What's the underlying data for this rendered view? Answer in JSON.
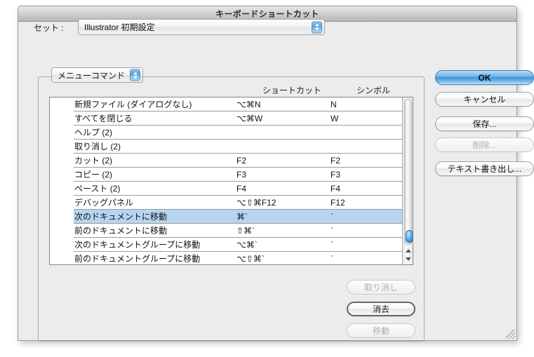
{
  "window": {
    "title": "キーボードショートカット"
  },
  "set_section": {
    "label": "セット :",
    "selected": "Illustrator 初期設定",
    "stepper_icon": "stepper-updown-icon"
  },
  "group": {
    "kind_selected": "メニューコマンド",
    "kind_stepper_icon": "stepper-updown-icon"
  },
  "columns": {
    "command": "",
    "shortcut": "ショートカット",
    "symbol": "シンボル"
  },
  "list": {
    "selected_index": 8,
    "rows": [
      {
        "command": "新規ファイル (ダイアログなし)",
        "shortcut": "⌥⌘N",
        "symbol": "N",
        "selected": false
      },
      {
        "command": "すべてを閉じる",
        "shortcut": "⌥⌘W",
        "symbol": "W",
        "selected": false
      },
      {
        "command": "ヘルプ (2)",
        "shortcut": "",
        "symbol": "",
        "selected": false
      },
      {
        "command": "取り消し (2)",
        "shortcut": "",
        "symbol": "",
        "selected": false
      },
      {
        "command": "カット (2)",
        "shortcut": "F2",
        "symbol": "F2",
        "selected": false
      },
      {
        "command": "コピー (2)",
        "shortcut": "F3",
        "symbol": "F3",
        "selected": false
      },
      {
        "command": "ペースト (2)",
        "shortcut": "F4",
        "symbol": "F4",
        "selected": false
      },
      {
        "command": "デバッグパネル",
        "shortcut": "⌥⇧⌘F12",
        "symbol": "F12",
        "selected": false
      },
      {
        "command": "次のドキュメントに移動",
        "shortcut": "⌘`",
        "symbol": "`",
        "selected": true
      },
      {
        "command": "前のドキュメントに移動",
        "shortcut": "⇧⌘`",
        "symbol": "`",
        "selected": false
      },
      {
        "command": "次のドキュメントグループに移動",
        "shortcut": "⌥⌘`",
        "symbol": "`",
        "selected": false
      },
      {
        "command": "前のドキュメントグループに移動",
        "shortcut": "⌥⇧⌘`",
        "symbol": "`",
        "selected": false
      }
    ]
  },
  "scrollbar": {
    "up_arrow_icon": "triangle-up-icon",
    "down_arrow_icon": "triangle-down-icon",
    "thumb_name": "scrollbar-thumb"
  },
  "side_buttons": {
    "ok": "OK",
    "cancel": "キャンセル",
    "save": "保存...",
    "delete": "削除...",
    "export_text": "テキスト書き出し..."
  },
  "bottom_buttons": {
    "undo": "取り消し",
    "clear": "消去",
    "go": "移動"
  },
  "colors": {
    "window_bg": "#ececec",
    "titlebar_top": "#e6e6e6",
    "titlebar_bottom": "#b8b8b8",
    "selection_blue": "#b7d5f1",
    "default_button_blue": "#3e96de",
    "scroll_thumb_blue": "#2f81cb",
    "list_separator": "#9b9b9b",
    "disabled_text": "#adadad"
  }
}
